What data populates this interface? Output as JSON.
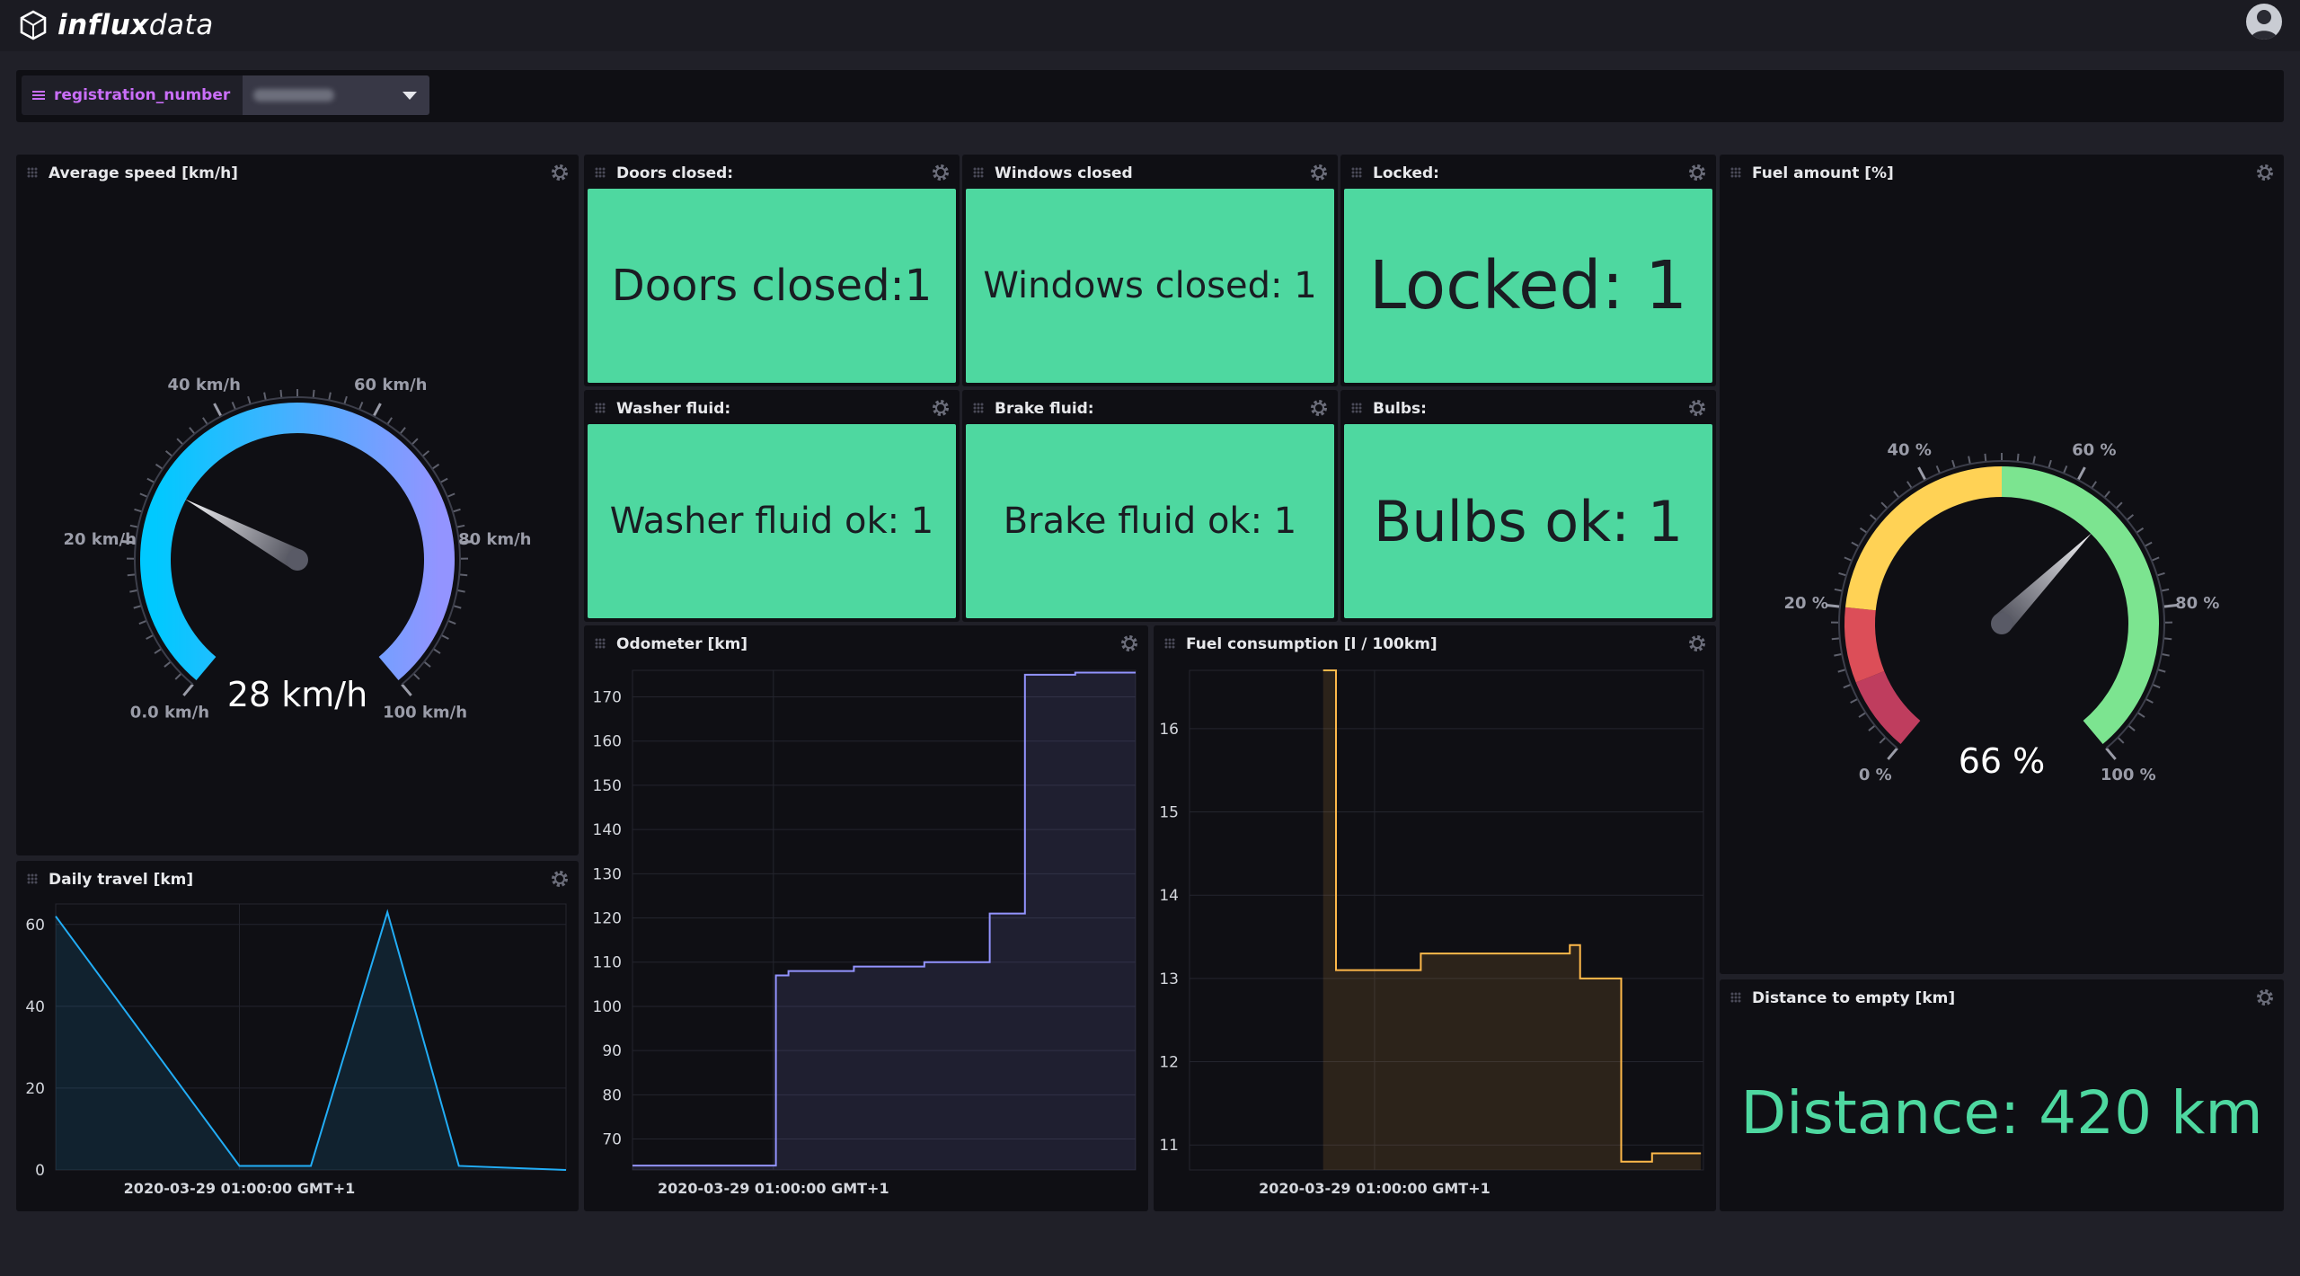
{
  "app": {
    "logo_bold": "influx",
    "logo_light": "data"
  },
  "variables": {
    "name": "registration_number",
    "value_hidden": true
  },
  "cells": {
    "avg_speed": {
      "title": "Average speed [km/h]",
      "value": 28,
      "unit": "km/h",
      "display": "28 km/h",
      "min": 0,
      "max": 100,
      "ticks": [
        "0.0 km/h",
        "20 km/h",
        "40 km/h",
        "60 km/h",
        "80 km/h",
        "100 km/h"
      ],
      "gradient": [
        "#00c9ff",
        "#9394ff"
      ]
    },
    "doors": {
      "title": "Doors closed:",
      "text": "Doors closed:1"
    },
    "windows": {
      "title": "Windows closed",
      "text": "Windows closed: 1"
    },
    "locked": {
      "title": "Locked:",
      "text": "Locked: 1"
    },
    "washer": {
      "title": "Washer fluid:",
      "text": "Washer fluid ok: 1"
    },
    "brake": {
      "title": "Brake fluid:",
      "text": "Brake fluid ok: 1"
    },
    "bulbs": {
      "title": "Bulbs:",
      "text": "Bulbs ok: 1"
    },
    "fuel_amount": {
      "title": "Fuel amount [%]",
      "value": 66,
      "display": "66 %",
      "min": 0,
      "max": 100,
      "ticks": [
        "0 %",
        "20 %",
        "40 %",
        "60 %",
        "80 %",
        "100 %"
      ],
      "bands": [
        {
          "from": 0,
          "to": 10,
          "color": "#bf3d5e"
        },
        {
          "from": 10,
          "to": 20,
          "color": "#dc4e58"
        },
        {
          "from": 20,
          "to": 50,
          "color": "#ffd255"
        },
        {
          "from": 50,
          "to": 100,
          "color": "#7ce490"
        }
      ]
    },
    "daily_travel": {
      "title": "Daily travel [km]",
      "x_label": "2020-03-29 01:00:00 GMT+1"
    },
    "odometer": {
      "title": "Odometer [km]",
      "x_label": "2020-03-29 01:00:00 GMT+1"
    },
    "fuel_consumption": {
      "title": "Fuel consumption [l / 100km]",
      "x_label": "2020-03-29 01:00:00 GMT+1"
    },
    "distance": {
      "title": "Distance to empty [km]",
      "text": "Distance: 420 km",
      "color": "#4ed8a0"
    }
  },
  "chart_data": [
    {
      "type": "area",
      "title": "Daily travel [km]",
      "xlabel": "2020-03-29 01:00:00 GMT+1",
      "ylim": [
        0,
        65
      ],
      "yticks": [
        0,
        20,
        40,
        60
      ],
      "color": "#22adf6",
      "x": [
        0,
        0.36,
        0.5,
        0.65,
        0.79,
        1.0
      ],
      "y": [
        62,
        1,
        1,
        63,
        1,
        0
      ]
    },
    {
      "type": "area",
      "title": "Odometer [km]",
      "xlabel": "2020-03-29 01:00:00 GMT+1",
      "ylim": [
        63,
        176
      ],
      "yticks": [
        70,
        80,
        90,
        100,
        110,
        120,
        130,
        140,
        150,
        160,
        170
      ],
      "color": "#9394ff",
      "step": true,
      "x": [
        0,
        0.28,
        0.285,
        0.31,
        0.44,
        0.58,
        0.69,
        0.71,
        0.76,
        0.78,
        0.88,
        1.0
      ],
      "y": [
        64,
        64,
        107,
        108,
        109,
        110,
        110,
        121,
        121,
        175,
        175.5,
        175.5
      ]
    },
    {
      "type": "area",
      "title": "Fuel consumption [l / 100km]",
      "xlabel": "2020-03-29 01:00:00 GMT+1",
      "ylim": [
        10.7,
        16.7
      ],
      "yticks": [
        11,
        12,
        13,
        14,
        15,
        16
      ],
      "color": "#ffb94a",
      "step": true,
      "x": [
        0.26,
        0.285,
        0.31,
        0.45,
        0.59,
        0.74,
        0.76,
        0.84,
        0.9,
        0.995
      ],
      "y": [
        16.7,
        13.1,
        13.1,
        13.3,
        13.3,
        13.4,
        13.0,
        10.8,
        10.9,
        10.9
      ]
    }
  ]
}
